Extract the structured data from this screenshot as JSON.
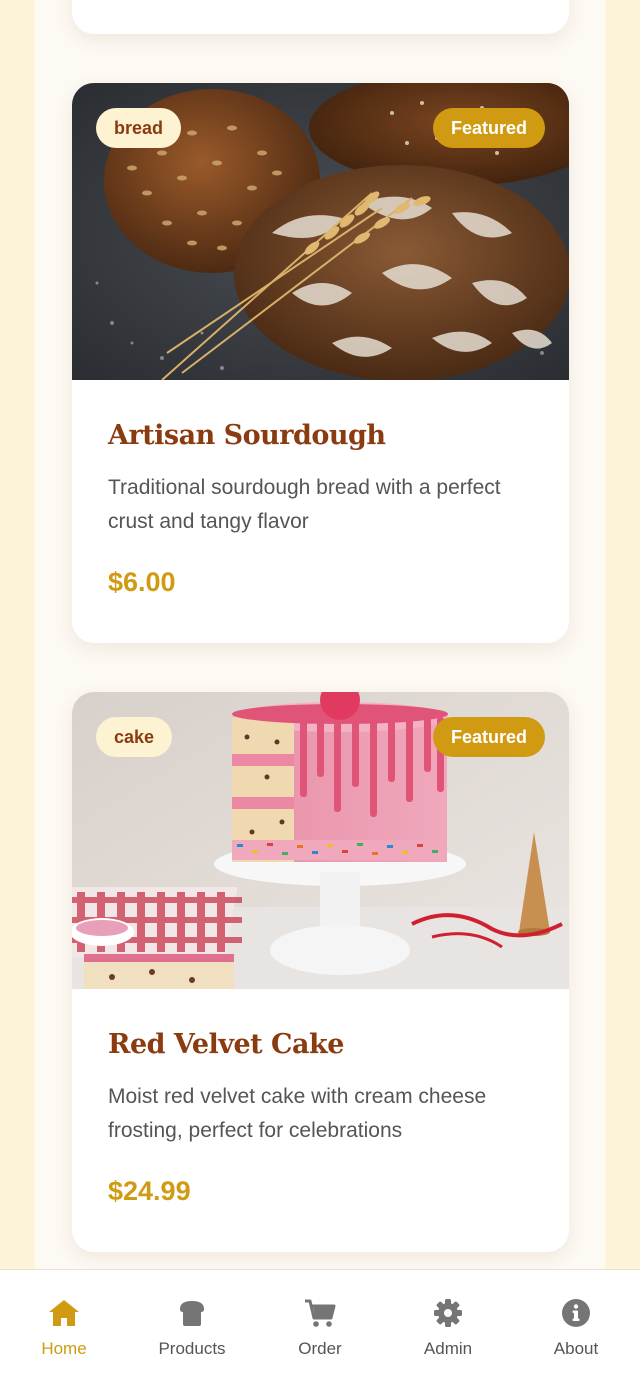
{
  "products": [
    {
      "category": "bread",
      "featured_label": "Featured",
      "title": "Artisan Sourdough",
      "description": "Traditional sourdough bread with a perfect crust and tangy flavor",
      "price": "$6.00"
    },
    {
      "category": "cake",
      "featured_label": "Featured",
      "title": "Red Velvet Cake",
      "description": "Moist red velvet cake with cream cheese frosting, perfect for celebrations",
      "price": "$24.99"
    }
  ],
  "nav": {
    "items": [
      {
        "label": "Home",
        "icon": "home-icon",
        "active": true
      },
      {
        "label": "Products",
        "icon": "bread-icon",
        "active": false
      },
      {
        "label": "Order",
        "icon": "cart-icon",
        "active": false
      },
      {
        "label": "Admin",
        "icon": "gear-icon",
        "active": false
      },
      {
        "label": "About",
        "icon": "info-icon",
        "active": false
      }
    ]
  },
  "colors": {
    "accent": "#d09b12",
    "title": "#8a3c10",
    "background": "#fdf3d8",
    "badge_bg": "#fdf3d3"
  }
}
